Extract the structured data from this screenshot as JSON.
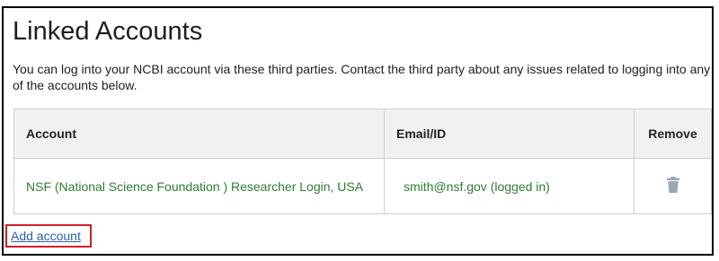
{
  "page": {
    "title": "Linked Accounts",
    "description": "You can log into your NCBI account via these third parties. Contact the third party about any issues related to logging into any of the accounts below."
  },
  "table": {
    "headers": {
      "account": "Account",
      "email": "Email/ID",
      "remove": "Remove"
    },
    "rows": [
      {
        "account": "NSF (National Science Foundation ) Researcher Login, USA",
        "email": "smith@nsf.gov (logged in)",
        "remove_icon": "trash-icon"
      }
    ]
  },
  "actions": {
    "add_account_label": "Add account"
  },
  "colors": {
    "link_green": "#2e7d32",
    "link_blue": "#2b5fab",
    "highlight_red": "#d21f26",
    "header_bg": "#f1f1f1",
    "trash_icon": "#9aa7b3"
  }
}
